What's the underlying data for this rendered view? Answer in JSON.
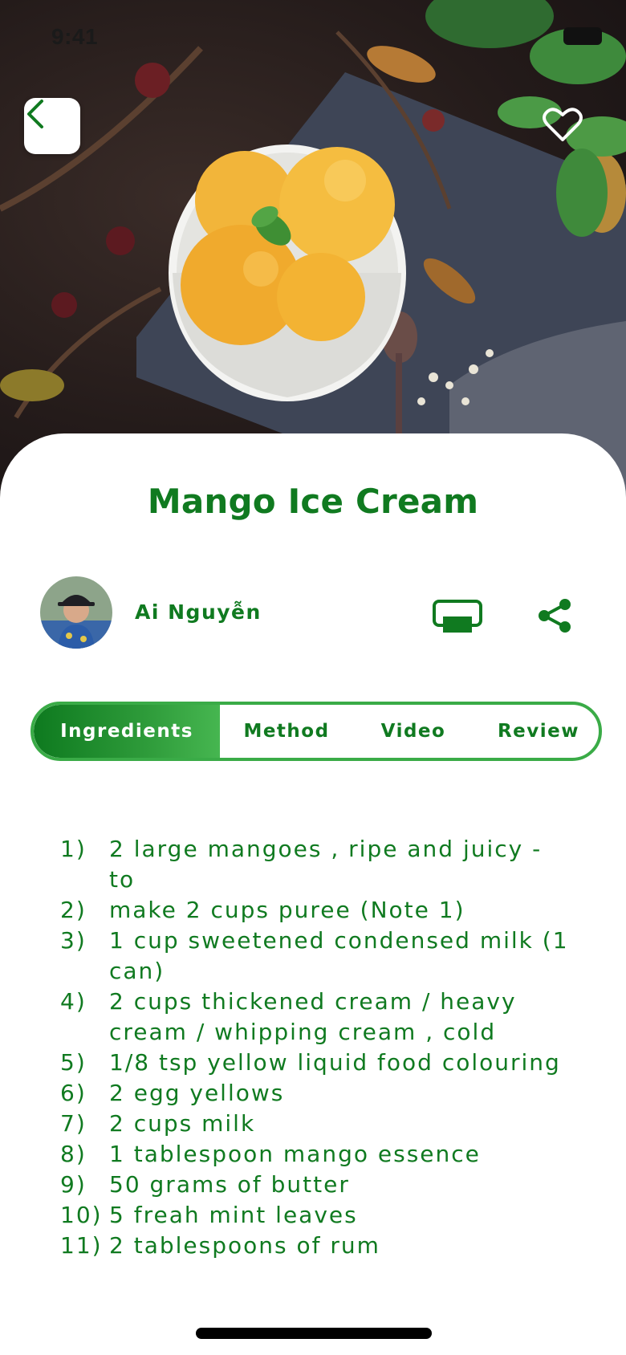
{
  "status_bar": {
    "time": "9:41"
  },
  "hero": {
    "image_description_icon": "mango-ice-cream-photo"
  },
  "header": {
    "back_icon": "chevron-left-icon",
    "favorite_icon": "heart-icon"
  },
  "recipe": {
    "title": "Mango Ice Cream"
  },
  "author": {
    "name": "Ai Nguyễn"
  },
  "actions": {
    "print_icon": "printer-icon",
    "share_icon": "share-icon"
  },
  "tabs": [
    {
      "label": "Ingredients",
      "active": true
    },
    {
      "label": "Method",
      "active": false
    },
    {
      "label": "Video",
      "active": false
    },
    {
      "label": "Review",
      "active": false
    }
  ],
  "ingredients": [
    {
      "num": "1)",
      "text": "2 large mangoes , ripe and juicy - to"
    },
    {
      "num": "2)",
      "text": "make 2 cups puree (Note 1)"
    },
    {
      "num": "3)",
      "text": "1 cup sweetened condensed milk (1 can)"
    },
    {
      "num": "4)",
      "text": "2 cups thickened cream / heavy cream / whipping cream , cold"
    },
    {
      "num": "5)",
      "text": "1/8 tsp yellow liquid food colouring"
    },
    {
      "num": "6)",
      "text": "2 egg yellows"
    },
    {
      "num": "7)",
      "text": "2 cups milk"
    },
    {
      "num": "8)",
      "text": "1 tablespoon mango essence"
    },
    {
      "num": "9)",
      "text": "50 grams of butter"
    },
    {
      "num": "10)",
      "text": "5 freah mint leaves"
    },
    {
      "num": "11)",
      "text": "2 tablespoons of rum"
    }
  ],
  "colors": {
    "primary_green": "#107a20",
    "tab_border": "#3aab47"
  }
}
